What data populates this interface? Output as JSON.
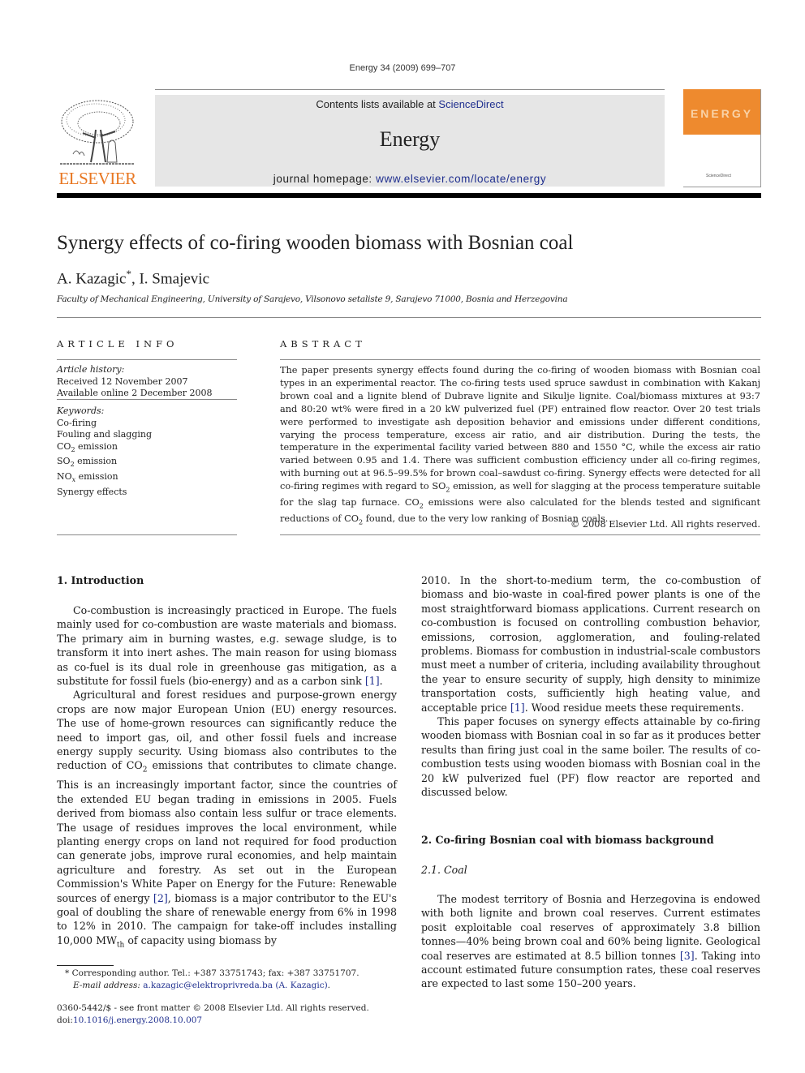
{
  "running_header": "Energy 34 (2009) 699–707",
  "masthead": {
    "contents_prefix": "Contents lists available at ",
    "contents_link": "ScienceDirect",
    "journal_name": "Energy",
    "homepage_prefix": "journal homepage: ",
    "homepage_link": "www.elsevier.com/locate/energy",
    "publisher_logo_text": "ELSEVIER",
    "cover_title": "ENERGY",
    "cover_footer": "ScienceDirect",
    "colors": {
      "publisher_orange": "#e87722",
      "cover_orange": "#ee8a2e",
      "banner_gray": "#e6e6e6",
      "link_blue": "#1f2f8f"
    }
  },
  "article": {
    "title": "Synergy effects of co-firing wooden biomass with Bosnian coal",
    "authors": [
      {
        "name": "A. Kazagic",
        "mark": "*"
      },
      {
        "name": "I. Smajevic",
        "mark": ""
      }
    ],
    "author_separator": ", ",
    "affiliation": "Faculty of Mechanical Engineering, University of Sarajevo, Vilsonovo setaliste 9, Sarajevo 71000, Bosnia and Herzegovina"
  },
  "article_info": {
    "heading": "ARTICLE INFO",
    "history_label": "Article history:",
    "received": "Received 12 November 2007",
    "available_online": "Available online 2 December 2008",
    "keywords_label": "Keywords:",
    "keywords": [
      {
        "base": "Co-firing",
        "sub": "",
        "rest": ""
      },
      {
        "base": "Fouling and slagging",
        "sub": "",
        "rest": ""
      },
      {
        "base": "CO",
        "sub": "2",
        "rest": " emission"
      },
      {
        "base": "SO",
        "sub": "2",
        "rest": " emission"
      },
      {
        "base": "NO",
        "sub": "x",
        "rest": " emission"
      },
      {
        "base": "Synergy effects",
        "sub": "",
        "rest": ""
      }
    ]
  },
  "abstract": {
    "heading": "ABSTRACT",
    "parts": [
      "The paper presents synergy effects found during the co-firing of wooden biomass with Bosnian coal types in an experimental reactor. The co-firing tests used spruce sawdust in combination with Kakanj brown coal and a lignite blend of Dubrave lignite and Sikulje lignite. Coal/biomass mixtures at 93:7 and 80:20 wt% were fired in a 20 kW pulverized fuel (PF) entrained flow reactor. Over 20 test trials were performed to investigate ash deposition behavior and emissions under different conditions, varying the process temperature, excess air ratio, and air distribution. During the tests, the temperature in the experimental facility varied between 880 and 1550 °C, while the excess air ratio varied between 0.95 and 1.4. There was sufficient combustion efficiency under all co-firing regimes, with burning out at 96.5–99.5% for brown coal–sawdust co-firing. Synergy effects were detected for all co-firing regimes with regard to SO",
      "2",
      " emission, as well for slagging at the process temperature suitable for the slag tap furnace. CO",
      "2",
      " emissions were also calculated for the blends tested and significant reductions of CO",
      "2",
      " found, due to the very low ranking of Bosnian coals."
    ],
    "copyright": "© 2008 Elsevier Ltd. All rights reserved."
  },
  "sections": {
    "intro_heading": "1.  Introduction",
    "intro_p1_a": "Co-combustion is increasingly practiced in Europe. The fuels mainly used for co-combustion are waste materials and biomass. The primary aim in burning wastes, e.g. sewage sludge, is to transform it into inert ashes. The main reason for using biomass as co-fuel is its dual role in greenhouse gas mitigation, as a substitute for fossil fuels (bio-energy) and as a carbon sink ",
    "intro_p1_ref": "[1]",
    "intro_p1_b": ".",
    "intro_p2_a": "Agricultural and forest residues and purpose-grown energy crops are now major European Union (EU) energy resources. The use of home-grown resources can significantly reduce the need to import gas, oil, and other fossil fuels and increase energy supply security. Using biomass also contributes to the reduction of CO",
    "intro_p2_sub": "2",
    "intro_p2_b": " emissions that contributes to climate change. This is an increasingly important factor, since the countries of the extended EU began trading in emissions in 2005. Fuels derived from biomass also contain less sulfur or trace elements. The usage of residues improves the local environment, while planting energy crops on land not required for food production can generate jobs, improve rural economies, and help maintain agriculture and forestry. As set out in the European Commission's White Paper on Energy for the Future: Renewable sources of energy ",
    "intro_p2_ref": "[2]",
    "intro_p2_c": ", biomass is a major contributor to the EU's goal of doubling the share of renewable energy from 6% in 1998 to 12% in 2010. The campaign for take-off includes installing 10,000 MW",
    "intro_p2_sub2": "th",
    "intro_p2_d": " of capacity using biomass by",
    "col2_p1_a": "2010. In the short-to-medium term, the co-combustion of biomass and bio-waste in coal-fired power plants is one of the most straightforward biomass applications. Current research on co-combustion is focused on controlling combustion behavior, emissions, corrosion, agglomeration, and fouling-related problems. Biomass for combustion in industrial-scale combustors must meet a number of criteria, including availability throughout the year to ensure security of supply, high density to minimize transportation costs, sufficiently high heating value, and acceptable price ",
    "col2_p1_ref": "[1]",
    "col2_p1_b": ". Wood residue meets these requirements.",
    "col2_p2": "This paper focuses on synergy effects attainable by co-firing wooden biomass with Bosnian coal in so far as it produces better results than firing just coal in the same boiler. The results of co-combustion tests using wooden biomass with Bosnian coal in the 20 kW pulverized fuel (PF) flow reactor are reported and discussed below.",
    "sec2_heading": "2.  Co-firing Bosnian coal with biomass background",
    "sec21_heading": "2.1.  Coal",
    "sec21_p1_a": "The modest territory of Bosnia and Herzegovina is endowed with both lignite and brown coal reserves. Current estimates posit exploitable coal reserves of approximately 3.8 billion tonnes—40% being brown coal and 60% being lignite. Geological coal reserves are estimated at 8.5 billion tonnes ",
    "sec21_p1_ref": "[3]",
    "sec21_p1_b": ". Taking into account estimated future consumption rates, these coal reserves are expected to last some 150–200 years."
  },
  "footnote": {
    "mark": "*",
    "corresponding": " Corresponding author. Tel.: +387 33751743; fax: +387 33751707.",
    "email_label": "E-mail address: ",
    "email_link": "a.kazagic@elektroprivreda.ba (A. Kazagic)",
    "email_end": "."
  },
  "front_matter": {
    "issn_line": "0360-5442/$ - see front matter © 2008 Elsevier Ltd. All rights reserved.",
    "doi_prefix": "doi:",
    "doi_link": "10.1016/j.energy.2008.10.007"
  }
}
